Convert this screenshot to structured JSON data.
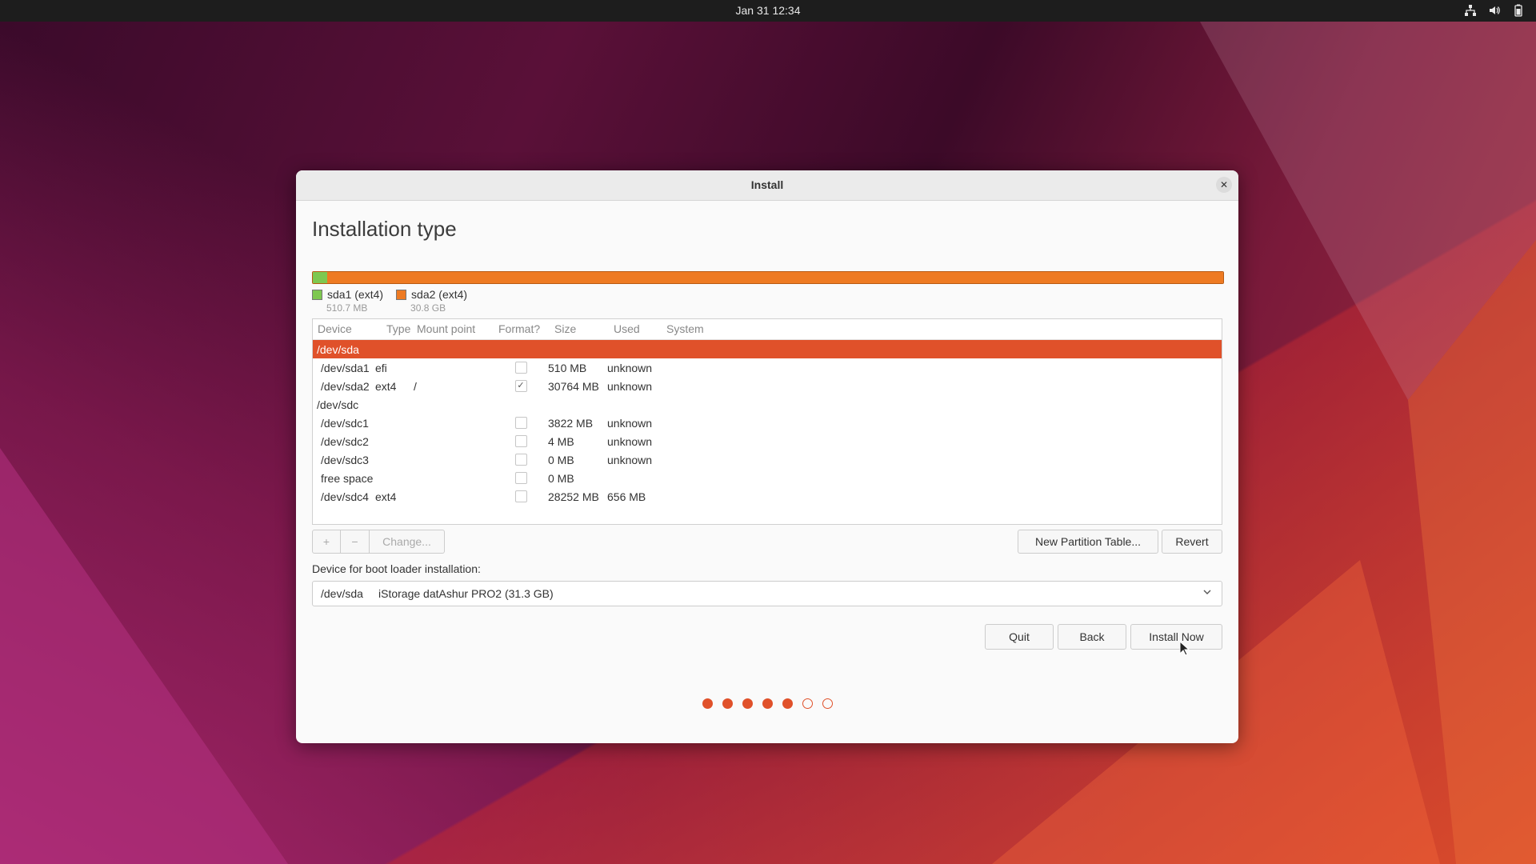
{
  "topbar": {
    "datetime": "Jan 31  12:34",
    "tray_icons": [
      "network-icon",
      "volume-icon",
      "battery-icon"
    ]
  },
  "window": {
    "title": "Install",
    "close_icon": "close-icon"
  },
  "page": {
    "title": "Installation type"
  },
  "partition_bar": {
    "segments": [
      {
        "name": "sda1 (ext4)",
        "size": "510.7 MB",
        "color": "#7ec850"
      },
      {
        "name": "sda2 (ext4)",
        "size": "30.8 GB",
        "color": "#ee7a22"
      }
    ]
  },
  "table": {
    "headers": {
      "device": "Device",
      "type": "Type",
      "mount": "Mount point",
      "format": "Format?",
      "size": "Size",
      "used": "Used",
      "system": "System"
    },
    "rows": [
      {
        "kind": "device",
        "device": "/dev/sda",
        "selected": true
      },
      {
        "kind": "partition",
        "device": "/dev/sda1",
        "type": "efi",
        "mount": "",
        "format": false,
        "size": "510 MB",
        "used": "unknown",
        "system": ""
      },
      {
        "kind": "partition",
        "device": "/dev/sda2",
        "type": "ext4",
        "mount": "/",
        "format": true,
        "size": "30764 MB",
        "used": "unknown",
        "system": ""
      },
      {
        "kind": "device",
        "device": "/dev/sdc",
        "selected": false
      },
      {
        "kind": "partition",
        "device": "/dev/sdc1",
        "type": "",
        "mount": "",
        "format": false,
        "size": "3822 MB",
        "used": "unknown",
        "system": ""
      },
      {
        "kind": "partition",
        "device": "/dev/sdc2",
        "type": "",
        "mount": "",
        "format": false,
        "size": "4 MB",
        "used": "unknown",
        "system": ""
      },
      {
        "kind": "partition",
        "device": "/dev/sdc3",
        "type": "",
        "mount": "",
        "format": false,
        "size": "0 MB",
        "used": "unknown",
        "system": ""
      },
      {
        "kind": "partition",
        "device": "free space",
        "type": "",
        "mount": "",
        "format": false,
        "size": "0 MB",
        "used": "",
        "system": ""
      },
      {
        "kind": "partition",
        "device": "/dev/sdc4",
        "type": "ext4",
        "mount": "",
        "format": false,
        "size": "28252 MB",
        "used": "656 MB",
        "system": ""
      }
    ]
  },
  "table_toolbar": {
    "add_label": "+",
    "remove_label": "−",
    "change_label": "Change...",
    "new_table_label": "New Partition Table...",
    "revert_label": "Revert"
  },
  "bootloader": {
    "label": "Device for boot loader installation:",
    "selected_device": "/dev/sda",
    "selected_description": "iStorage datAshur PRO2 (31.3 GB)"
  },
  "actions": {
    "quit_label": "Quit",
    "back_label": "Back",
    "install_label": "Install Now"
  },
  "progress": {
    "total_steps": 7,
    "completed_steps": 5
  },
  "colors": {
    "accent": "#e0512a",
    "topbar": "#1d1d1d"
  }
}
